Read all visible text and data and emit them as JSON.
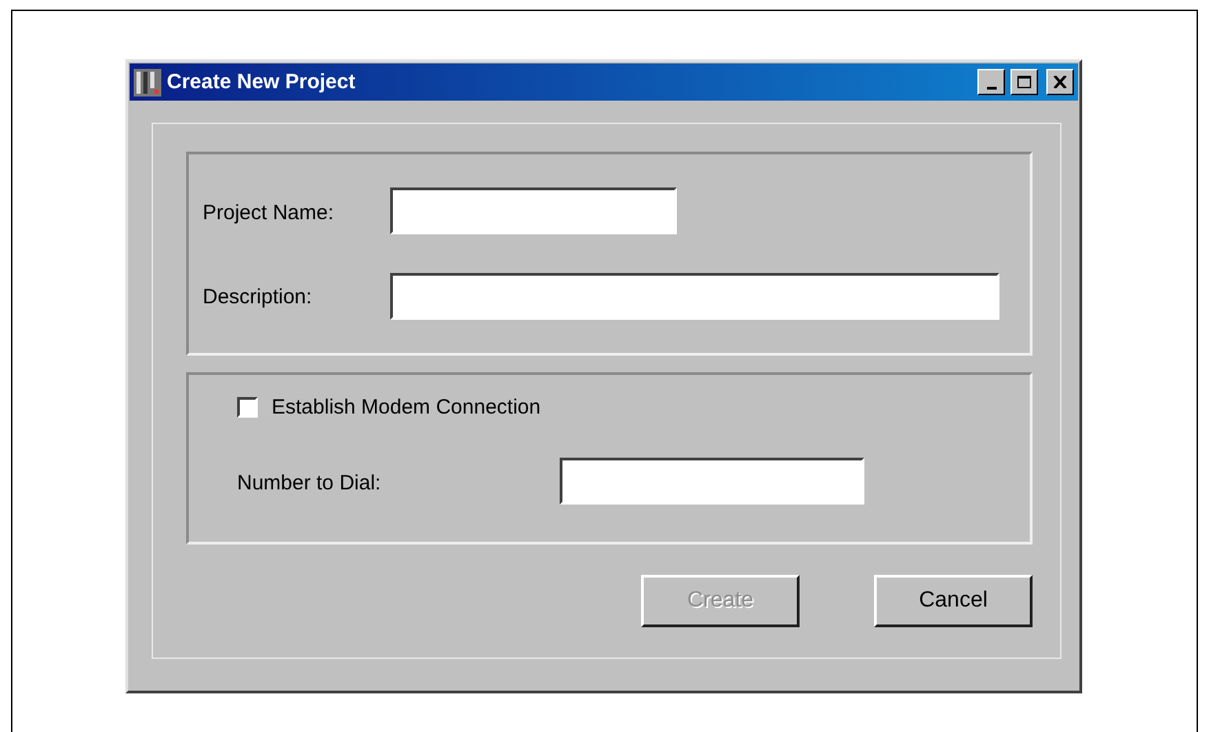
{
  "window": {
    "title": "Create New Project"
  },
  "project_group": {
    "fields": [
      {
        "label": "Project Name:",
        "kind": "short"
      },
      {
        "label": "Description:",
        "kind": "long"
      }
    ]
  },
  "modem_group": {
    "checkbox": {
      "label": "Establish Modem Connection",
      "checked": false
    },
    "field": {
      "label": "Number to Dial:"
    }
  },
  "buttons": [
    {
      "label": "Create",
      "disabled": true
    },
    {
      "label": "Cancel",
      "disabled": false
    }
  ]
}
